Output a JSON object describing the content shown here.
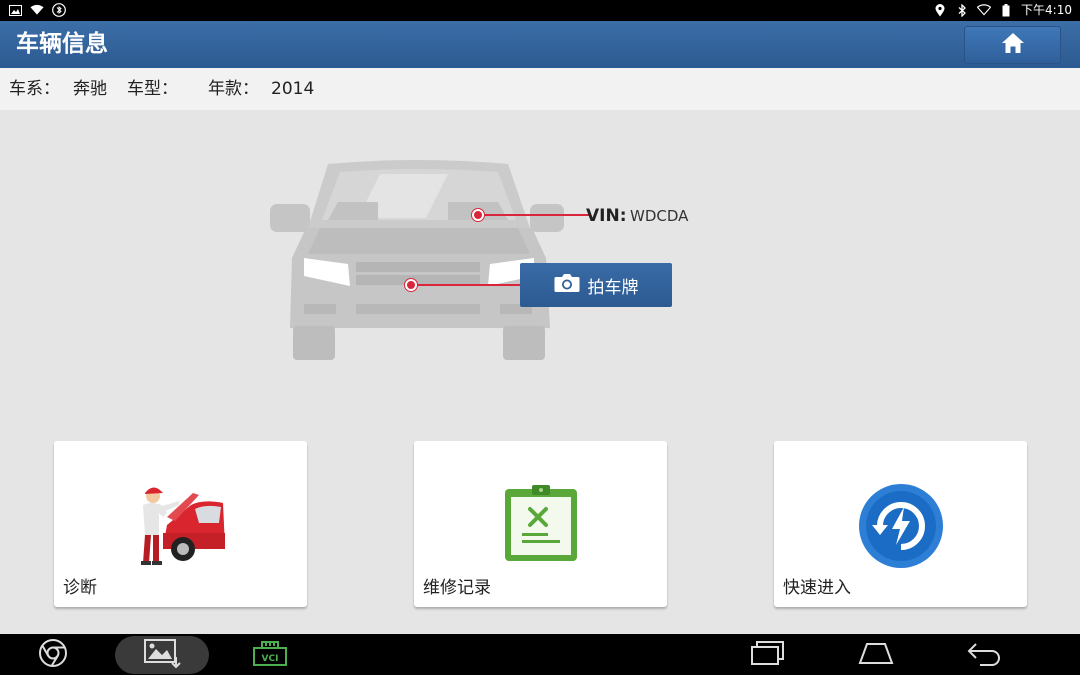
{
  "status_bar": {
    "time": "下午4:10",
    "left_icons": [
      "image-icon",
      "wifi-icon",
      "bluetooth-icon"
    ],
    "right_icons": [
      "location-icon",
      "bluetooth-icon",
      "wifi-icon",
      "battery-icon"
    ]
  },
  "header": {
    "title": "车辆信息",
    "home_icon": "home-icon"
  },
  "info": {
    "series_label": "车系：",
    "series_value": "奔驰",
    "model_label": "车型：",
    "model_value": "",
    "year_label": "年款：",
    "year_value": "2014"
  },
  "car": {
    "vin_label": "VIN:",
    "vin_value": "WDCDA",
    "plate_button_label": "拍车牌",
    "plate_icon": "camera-icon"
  },
  "tiles": [
    {
      "label": "诊断",
      "icon": "mechanic-car-icon"
    },
    {
      "label": "维修记录",
      "icon": "repair-record-clipboard-icon"
    },
    {
      "label": "快速进入",
      "icon": "quick-entry-icon"
    }
  ],
  "nav_bar": {
    "items": [
      "browser-icon",
      "gallery-icon",
      "vci-icon",
      "recent-apps-icon",
      "home-nav-icon",
      "back-icon"
    ],
    "vci_text": "VCI"
  },
  "colors": {
    "header_blue": "#2c5a91",
    "accent_red": "#d9263a",
    "background": "#e5e5e5"
  }
}
